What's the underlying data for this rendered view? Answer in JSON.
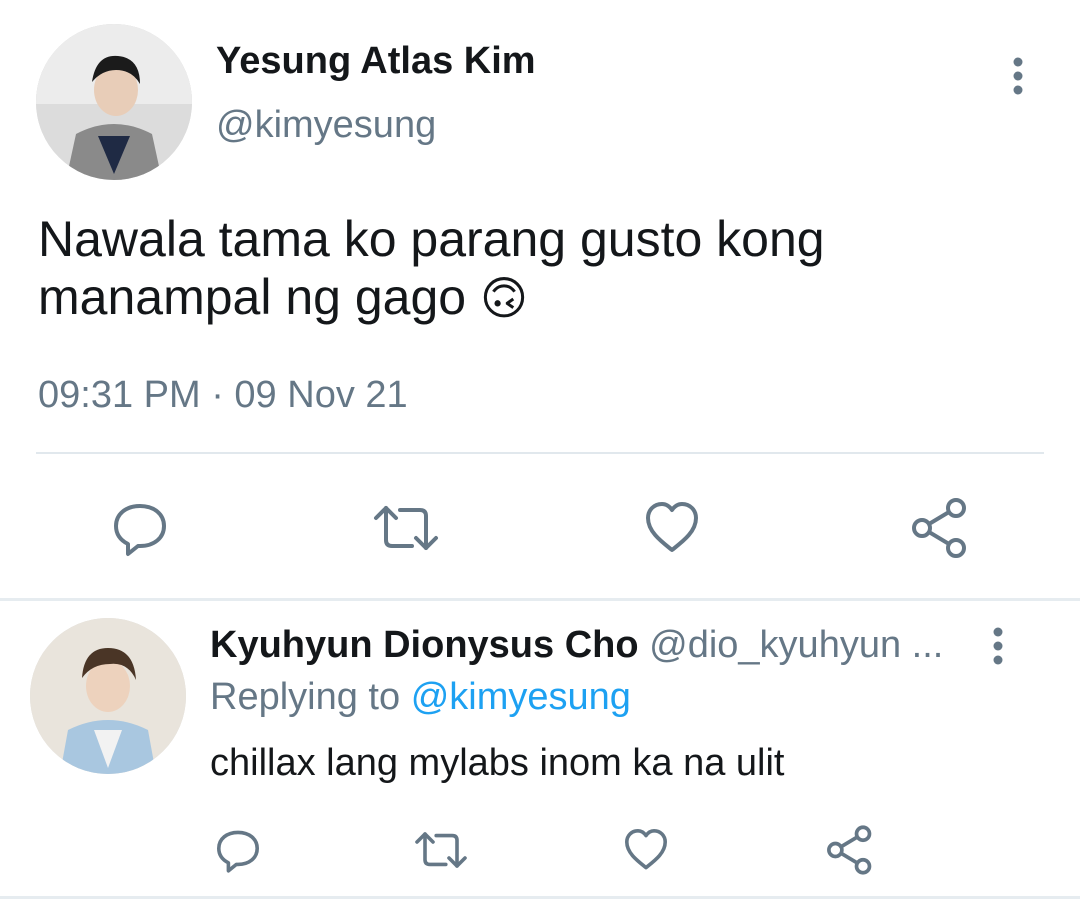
{
  "tweet": {
    "author_name": "Yesung Atlas Kim",
    "author_handle": "@kimyesung",
    "text_line1": "Nawala tama ko parang gusto kong",
    "text_line2": "manampal ng gago",
    "emoji": "🙃",
    "timestamp": "09:31 PM · 09 Nov 21",
    "actions": [
      "reply-icon",
      "retweet-icon",
      "like-icon",
      "share-icon"
    ]
  },
  "reply": {
    "author_name": "Kyuhyun Dionysus Cho",
    "author_handle": "@dio_kyuhyun ...",
    "replying_prefix": "Replying to",
    "replying_handle": "@kimyesung",
    "text": "chillax lang mylabs inom ka na ulit",
    "actions": [
      "reply-icon",
      "retweet-icon",
      "like-icon",
      "share-icon"
    ]
  },
  "colors": {
    "text": "#14171a",
    "secondary": "#657786",
    "link": "#1da1f2",
    "divider": "#e1e8ed",
    "icon": "#657786"
  }
}
